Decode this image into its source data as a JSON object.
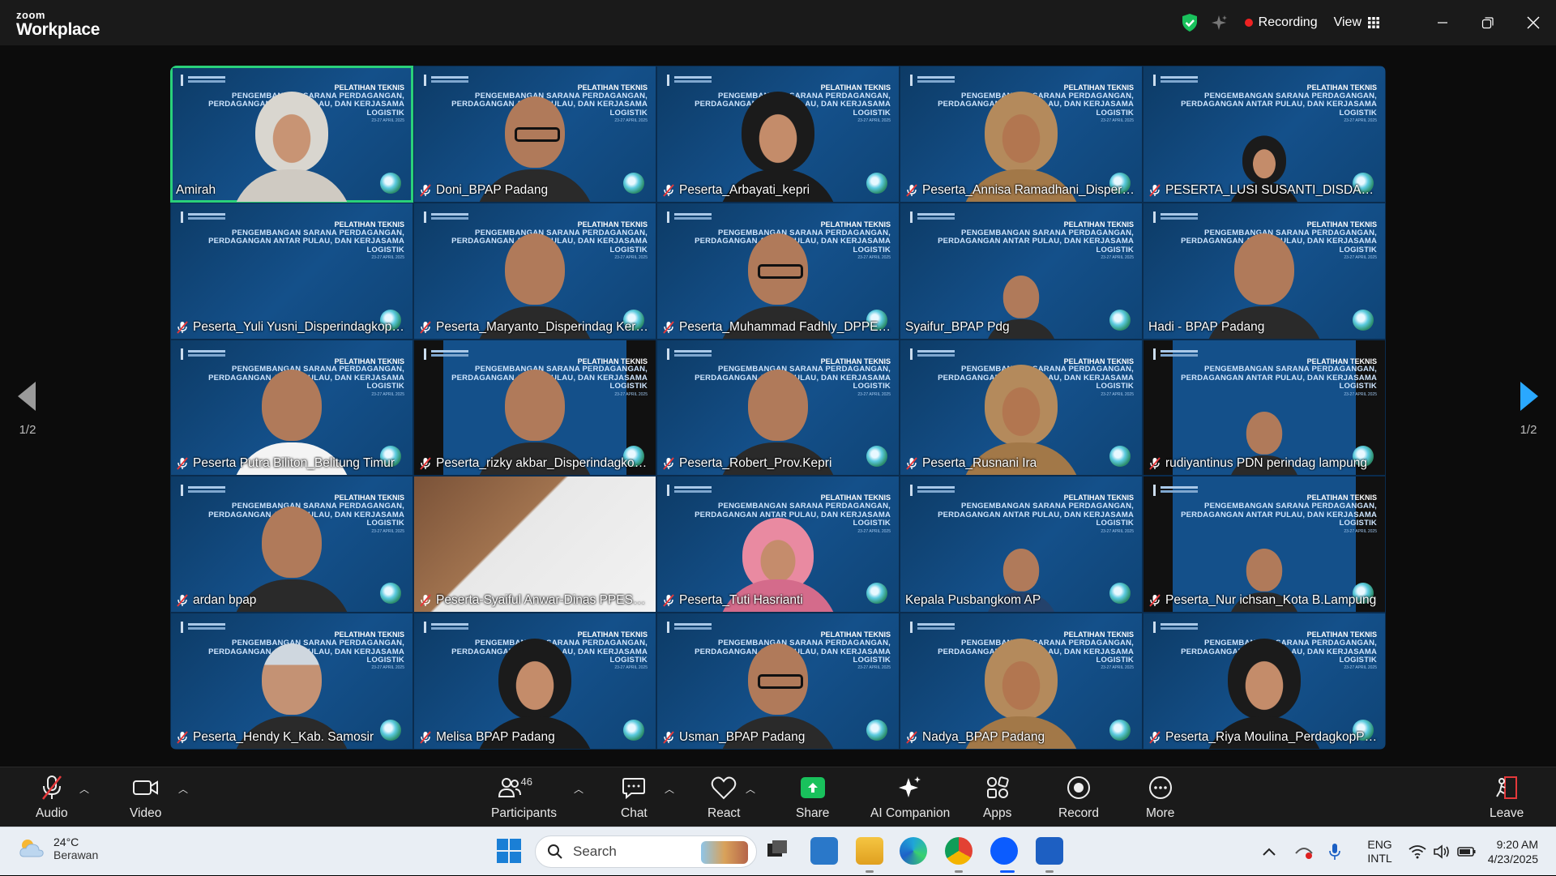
{
  "app": {
    "logo_line1": "zoom",
    "logo_line2": "Workplace"
  },
  "titlebar": {
    "recording_label": "Recording",
    "view_label": "View"
  },
  "slide": {
    "line1": "PELATIHAN TEKNIS",
    "line2": "PENGEMBANGAN SARANA PERDAGANGAN,",
    "line3": "PERDAGANGAN ANTAR PULAU, DAN KERJASAMA LOGISTIK",
    "date": "23-27 APRIL 2025"
  },
  "pager": {
    "left": "1/2",
    "right": "1/2"
  },
  "participants": [
    {
      "name": "Amirah",
      "muted": false
    },
    {
      "name": "Doni_BPAP Padang",
      "muted": true
    },
    {
      "name": "Peserta_Arbayati_kepri",
      "muted": true
    },
    {
      "name": "Peserta_Annisa Ramadhani_Disperin...",
      "muted": true
    },
    {
      "name": "PESERTA_LUSI SUSANTI_DISDAGIN K...",
      "muted": true
    },
    {
      "name": "Peserta_Yuli Yusni_Disperindagkop.OI",
      "muted": true
    },
    {
      "name": "Peserta_Maryanto_Disperindag Kerinci",
      "muted": true
    },
    {
      "name": "Peserta_Muhammad Fadhly_DPPESD...",
      "muted": true
    },
    {
      "name": "Syaifur_BPAP Pdg",
      "muted": false
    },
    {
      "name": "Hadi - BPAP Padang",
      "muted": false
    },
    {
      "name": "Peserta Putra Biliton_Belitung Timur",
      "muted": true
    },
    {
      "name": "Peserta_rizky akbar_Disperindagkop ...",
      "muted": true
    },
    {
      "name": "Peserta_Robert_Prov.Kepri",
      "muted": true
    },
    {
      "name": "Peserta_Rusnani Ira",
      "muted": true
    },
    {
      "name": "rudiyantinus PDN perindag lampung",
      "muted": true
    },
    {
      "name": "ardan bpap",
      "muted": true
    },
    {
      "name": "Peserta-Syaiful Anwar-Dinas PPESD...",
      "muted": true
    },
    {
      "name": "Peserta_Tuti Hasrianti",
      "muted": true
    },
    {
      "name": "Kepala Pusbangkom AP",
      "muted": false
    },
    {
      "name": "Peserta_Nur  ichsan_Kota B.Lampung",
      "muted": true
    },
    {
      "name": "Peserta_Hendy K_Kab. Samosir",
      "muted": true
    },
    {
      "name": "Melisa BPAP Padang",
      "muted": true
    },
    {
      "name": "Usman_BPAP Padang",
      "muted": true
    },
    {
      "name": "Nadya_BPAP Padang",
      "muted": true
    },
    {
      "name": "Peserta_Riya Moulina_PerdagkopPad...",
      "muted": true
    }
  ],
  "toolbar": {
    "audio": "Audio",
    "video": "Video",
    "participants": "Participants",
    "participants_count": "46",
    "chat": "Chat",
    "react": "React",
    "share": "Share",
    "ai_companion": "AI Companion",
    "apps": "Apps",
    "record": "Record",
    "more": "More",
    "leave": "Leave"
  },
  "taskbar": {
    "temperature": "24°C",
    "weather": "Berawan",
    "search_placeholder": "Search",
    "lang1": "ENG",
    "lang2": "INTL",
    "time": "9:20 AM",
    "date": "4/23/2025"
  },
  "colors": {
    "active_speaker": "#2ad17a",
    "recording": "#e22222",
    "share": "#19c15c",
    "slide_bg": "#14508a"
  }
}
